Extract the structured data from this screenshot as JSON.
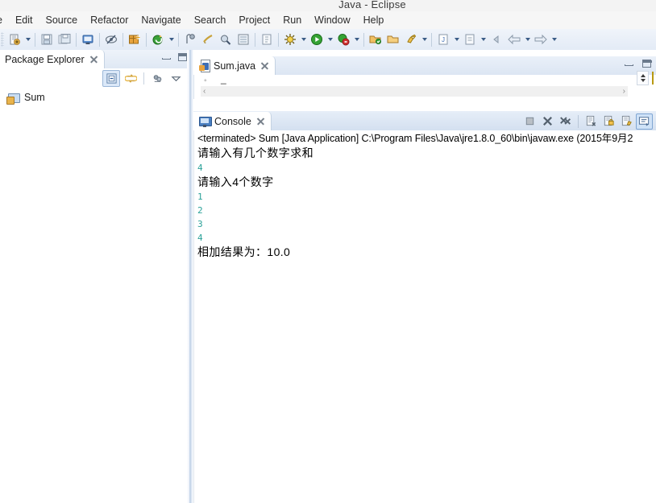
{
  "window": {
    "title": "Java - Eclipse"
  },
  "menubar": {
    "items": [
      {
        "label": "e",
        "name": "menu-file"
      },
      {
        "label": "Edit",
        "name": "menu-edit"
      },
      {
        "label": "Source",
        "name": "menu-source"
      },
      {
        "label": "Refactor",
        "name": "menu-refactor"
      },
      {
        "label": "Navigate",
        "name": "menu-navigate"
      },
      {
        "label": "Search",
        "name": "menu-search"
      },
      {
        "label": "Project",
        "name": "menu-project"
      },
      {
        "label": "Run",
        "name": "menu-run"
      },
      {
        "label": "Window",
        "name": "menu-window"
      },
      {
        "label": "Help",
        "name": "menu-help"
      }
    ]
  },
  "toolbar": {
    "icons": [
      "new-wizard-icon",
      "new-wizard-dropdown-icon",
      "save-icon",
      "save-all-icon",
      "print-icon",
      "toggle-mark-occurrences-icon",
      "new-java-package-icon",
      "external-tools-icon",
      "external-tools-dropdown-icon",
      "search-icon",
      "open-task-icon",
      "skip-breakpoints-icon",
      "open-type-icon",
      "toggle-breadcrumb-icon",
      "debug-icon",
      "debug-dropdown-icon",
      "run-icon",
      "run-dropdown-icon",
      "coverage-icon",
      "coverage-dropdown-icon",
      "open-folder-icon",
      "open-folder-2-icon",
      "run-as-icon",
      "run-as-dropdown-icon",
      "new-java-class-icon",
      "new-java-class-dropdown-icon",
      "new-java-interface-icon",
      "new-java-interface-dropdown-icon",
      "previous-annotation-icon",
      "back-icon",
      "back-dropdown-icon",
      "forward-icon",
      "forward-dropdown-icon"
    ]
  },
  "package_explorer": {
    "tab_label": "Package Explorer",
    "toolbar_icons": [
      "collapse-all-icon",
      "link-with-editor-icon",
      "view-filters-icon",
      "view-menu-icon"
    ],
    "tree": [
      {
        "label": "Sum",
        "icon": "java-project-icon"
      }
    ]
  },
  "editor": {
    "tab_label": "Sum.java",
    "tab_icon": "java-file-icon",
    "scroll_left_glyph": "‹",
    "scroll_right_glyph": "›",
    "ruler_glyph": "°"
  },
  "console": {
    "tab_label": "Console",
    "tab_icon": "console-icon",
    "toolbar_icons": [
      "terminate-icon",
      "remove-launch-icon",
      "remove-all-terminated-icon",
      "clear-console-icon",
      "scroll-lock-icon",
      "pin-console-icon",
      "display-selected-console-icon"
    ],
    "lines": [
      {
        "type": "header",
        "text": "<terminated> Sum [Java Application] C:\\Program Files\\Java\\jre1.8.0_60\\bin\\javaw.exe (2015年9月2"
      },
      {
        "type": "output",
        "text": "请输入有几个数字求和"
      },
      {
        "type": "input",
        "text": "4"
      },
      {
        "type": "output",
        "text": "请输入4个数字"
      },
      {
        "type": "input",
        "text": "1"
      },
      {
        "type": "input",
        "text": "2"
      },
      {
        "type": "input",
        "text": "3"
      },
      {
        "type": "input",
        "text": "4"
      },
      {
        "type": "output",
        "text": "相加结果为：10.0"
      }
    ]
  },
  "colors": {
    "input_text": "#2aa198",
    "output_text": "#000000",
    "toolbar_bg": "#e3ebf6",
    "tab_active_bg": "#ffffff",
    "accent": "#7fa6d3"
  }
}
